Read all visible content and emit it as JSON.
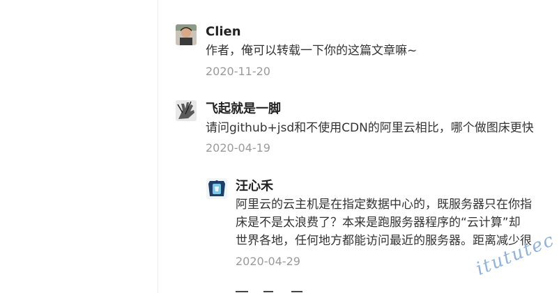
{
  "comments": [
    {
      "author": "Clien",
      "avatar_icon": "boy-photo-avatar",
      "text": "作者，俺可以转载一下你的这篇文章嘛~",
      "date": "2020-11-20"
    },
    {
      "author": "飞起就是一脚",
      "avatar_icon": "grayscale-hand-avatar",
      "text": "请问github+jsd和不使用CDN的阿里云相比，哪个做图床更快",
      "date": "2020-04-19",
      "reply": {
        "author": "汪心禾",
        "avatar_icon": "blue-frame-avatar",
        "lines": [
          "阿里云的云主机是在指定数据中心的，既服务器只在你指",
          "床是不是太浪费了？本来是跑服务器程序的“云计算”却",
          "世界各地，任何地方都能访问最近的服务器。距离减少很"
        ],
        "date": "2020-04-29"
      }
    }
  ],
  "watermark": "itututec"
}
